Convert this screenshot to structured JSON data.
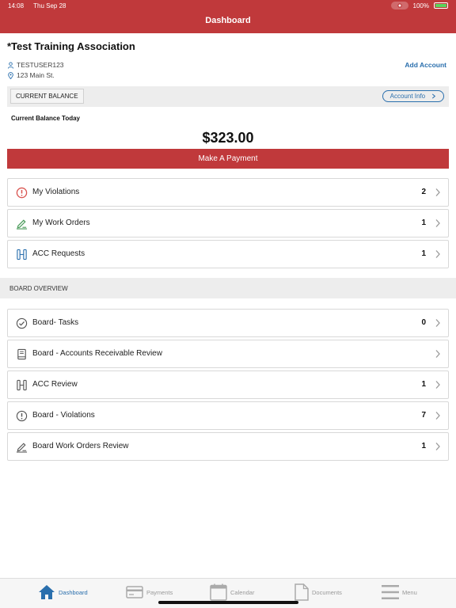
{
  "status_bar": {
    "time": "14:08",
    "date": "Thu Sep 28",
    "battery": "100%"
  },
  "header": {
    "title": "Dashboard"
  },
  "account": {
    "name": "*Test Training Association",
    "username": "TESTUSER123",
    "address": "123 Main St.",
    "add_account_label": "Add Account"
  },
  "balance": {
    "current_balance_label": "CURRENT BALANCE",
    "account_info_label": "Account Info",
    "today_label": "Current Balance Today",
    "amount": "$323.00",
    "pay_label": "Make A Payment"
  },
  "my_items": [
    {
      "label": "My Violations",
      "count": "2",
      "icon": "alert-circle-icon",
      "color": "#d9534f"
    },
    {
      "label": "My Work Orders",
      "count": "1",
      "icon": "pencil-icon",
      "color": "#4a9b5a"
    },
    {
      "label": "ACC Requests",
      "count": "1",
      "icon": "columns-icon",
      "color": "#2a6fad"
    }
  ],
  "board": {
    "section_label": "BOARD OVERVIEW",
    "items": [
      {
        "label": "Board- Tasks",
        "count": "0",
        "icon": "check-circle-icon"
      },
      {
        "label": "Board - Accounts Receivable Review",
        "count": "",
        "icon": "book-icon"
      },
      {
        "label": "ACC Review",
        "count": "1",
        "icon": "columns-icon"
      },
      {
        "label": "Board - Violations",
        "count": "7",
        "icon": "alert-circle-icon"
      },
      {
        "label": "Board Work Orders Review",
        "count": "1",
        "icon": "pencil-icon"
      }
    ]
  },
  "tabs": [
    {
      "label": "Dashboard",
      "icon": "home-icon",
      "active": true
    },
    {
      "label": "Payments",
      "icon": "card-icon",
      "active": false
    },
    {
      "label": "Calendar",
      "icon": "calendar-icon",
      "active": false
    },
    {
      "label": "Documents",
      "icon": "document-icon",
      "active": false
    },
    {
      "label": "Menu",
      "icon": "menu-icon",
      "active": false
    }
  ],
  "colors": {
    "brand": "#c0393b",
    "link": "#2a6fad",
    "section_bg": "#ededed"
  }
}
